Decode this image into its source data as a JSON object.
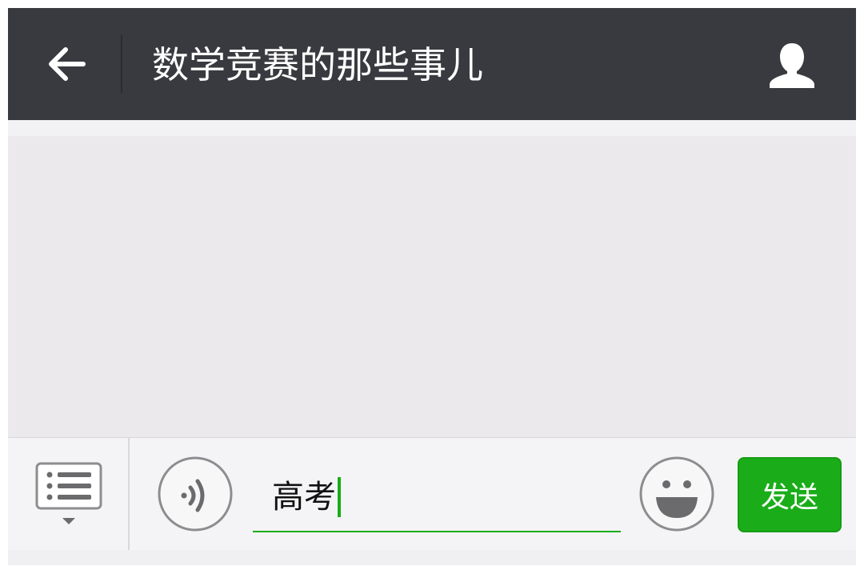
{
  "header": {
    "title": "数学竞赛的那些事儿",
    "back_icon": "back-arrow-icon",
    "profile_icon": "person-icon"
  },
  "chat": {
    "messages": []
  },
  "input_bar": {
    "menu_icon": "menu-list-icon",
    "voice_icon": "voice-icon",
    "emoji_icon": "emoji-icon",
    "text_value": "高考",
    "send_label": "发送"
  },
  "colors": {
    "header_bg": "#393a3f",
    "accent_green": "#1aad19",
    "chat_bg": "#ebe9ec",
    "input_bar_bg": "#f4f4f6"
  }
}
